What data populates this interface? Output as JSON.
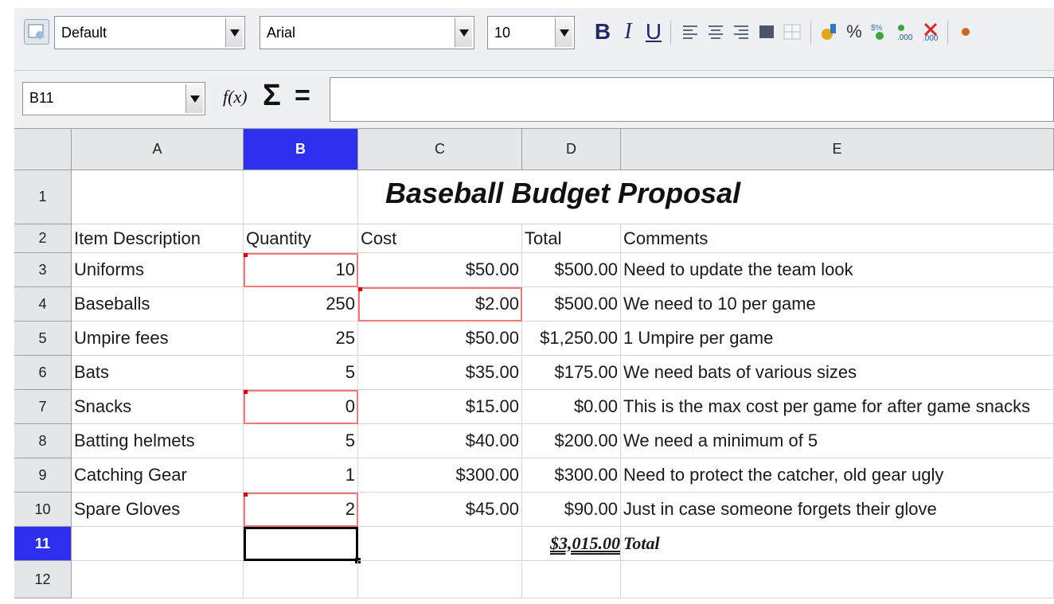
{
  "toolbar": {
    "style_value": "Default",
    "font_value": "Arial",
    "size_value": "10",
    "bold": "B",
    "italic": "I",
    "underline": "U",
    "percent": "%",
    "currency": "$%"
  },
  "formula_bar": {
    "cell_ref": "B11",
    "fx": "f(x)",
    "sum": "Σ",
    "equals": "=",
    "content": ""
  },
  "sheet": {
    "columns": [
      "A",
      "B",
      "C",
      "D",
      "E"
    ],
    "rows": [
      "1",
      "2",
      "3",
      "4",
      "5",
      "6",
      "7",
      "8",
      "9",
      "10",
      "11",
      "12"
    ],
    "title": "Baseball Budget Proposal",
    "headers": {
      "a": "Item Description",
      "b": "Quantity",
      "c": "Cost",
      "d": "Total",
      "e": "Comments"
    },
    "items": [
      {
        "desc": "Uniforms",
        "qty": "10",
        "cost": "$50.00",
        "total": "$500.00",
        "comment": "Need to update the team look"
      },
      {
        "desc": "Baseballs",
        "qty": "250",
        "cost": "$2.00",
        "total": "$500.00",
        "comment": "We need to 10 per game"
      },
      {
        "desc": "Umpire fees",
        "qty": "25",
        "cost": "$50.00",
        "total": "$1,250.00",
        "comment": "1 Umpire per game"
      },
      {
        "desc": "Bats",
        "qty": "5",
        "cost": "$35.00",
        "total": "$175.00",
        "comment": "We need bats of various sizes"
      },
      {
        "desc": "Snacks",
        "qty": "0",
        "cost": "$15.00",
        "total": "$0.00",
        "comment": "This is the max cost per game for after game snacks"
      },
      {
        "desc": "Batting helmets",
        "qty": "5",
        "cost": "$40.00",
        "total": "$200.00",
        "comment": "We need a minimum of 5"
      },
      {
        "desc": "Catching Gear",
        "qty": "1",
        "cost": "$300.00",
        "total": "$300.00",
        "comment": "Need to protect the catcher, old gear ugly"
      },
      {
        "desc": "Spare Gloves",
        "qty": "2",
        "cost": "$45.00",
        "total": "$90.00",
        "comment": "Just in case someone forgets their glove"
      }
    ],
    "grand_total": "$3,015.00",
    "grand_total_label": "Total"
  },
  "colors": {
    "selected_header": "#2f2ff0",
    "comment_marker": "#e00000",
    "cell_highlight": "#f07a7a"
  }
}
